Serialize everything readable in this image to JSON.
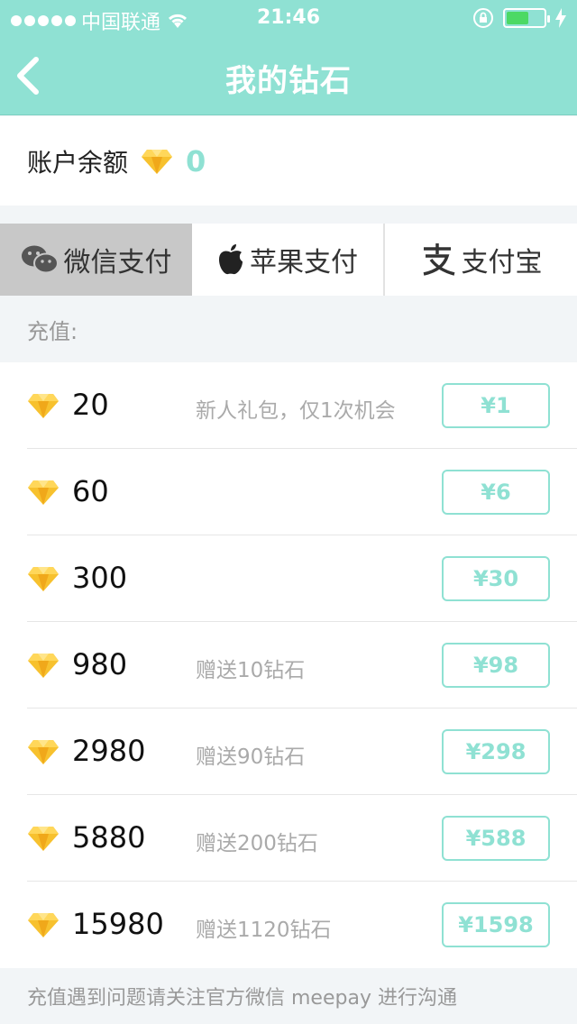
{
  "status_bar": {
    "carrier": "中国联通",
    "time": "21:46",
    "battery_level": 0.6
  },
  "nav": {
    "title": "我的钻石",
    "back_icon": "chevron-left-icon"
  },
  "balance": {
    "label": "账户余额",
    "value": "0"
  },
  "tabs": [
    {
      "label": "微信支付",
      "icon": "wechat-icon",
      "selected": true
    },
    {
      "label": "苹果支付",
      "icon": "apple-icon",
      "selected": false
    },
    {
      "label": "支付宝",
      "icon": "alipay-icon",
      "selected": false
    }
  ],
  "recharge_label": "充值:",
  "packages": [
    {
      "amount": "20",
      "note": "新人礼包，仅1次机会",
      "price": "¥1"
    },
    {
      "amount": "60",
      "note": "",
      "price": "¥6"
    },
    {
      "amount": "300",
      "note": "",
      "price": "¥30"
    },
    {
      "amount": "980",
      "note": "赠送10钻石",
      "price": "¥98"
    },
    {
      "amount": "2980",
      "note": "赠送90钻石",
      "price": "¥298"
    },
    {
      "amount": "5880",
      "note": "赠送200钻石",
      "price": "¥588"
    },
    {
      "amount": "15980",
      "note": "赠送1120钻石",
      "price": "¥1598"
    }
  ],
  "footer": "充值遇到问题请关注官方微信 meepay 进行沟通",
  "colors": {
    "accent": "#8fe1d3",
    "gem": "#f5b820"
  }
}
